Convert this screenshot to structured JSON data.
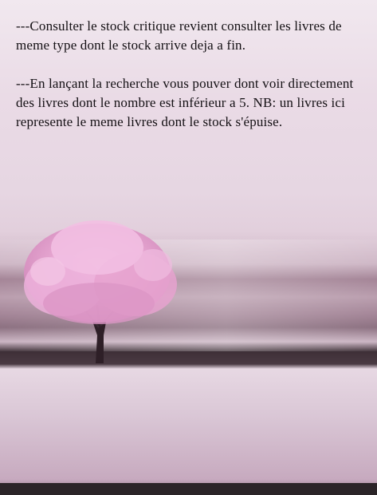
{
  "content": {
    "paragraph_1": "---Consulter le stock critique revient consulter les livres de meme type dont le stock arrive deja a fin.",
    "paragraph_2": "---En lançant la recherche vous pouver dont voir directement des livres dont le nombre est inférieur a 5. NB: un livres ici represente le meme livres dont le stock s'épuise."
  },
  "colors": {
    "text": "#141014",
    "background": "#efe3ec",
    "blossom": "#e8a6d2",
    "trunk": "#2e1f27"
  },
  "image": {
    "subject": "pink-blossom-tree-icon"
  }
}
